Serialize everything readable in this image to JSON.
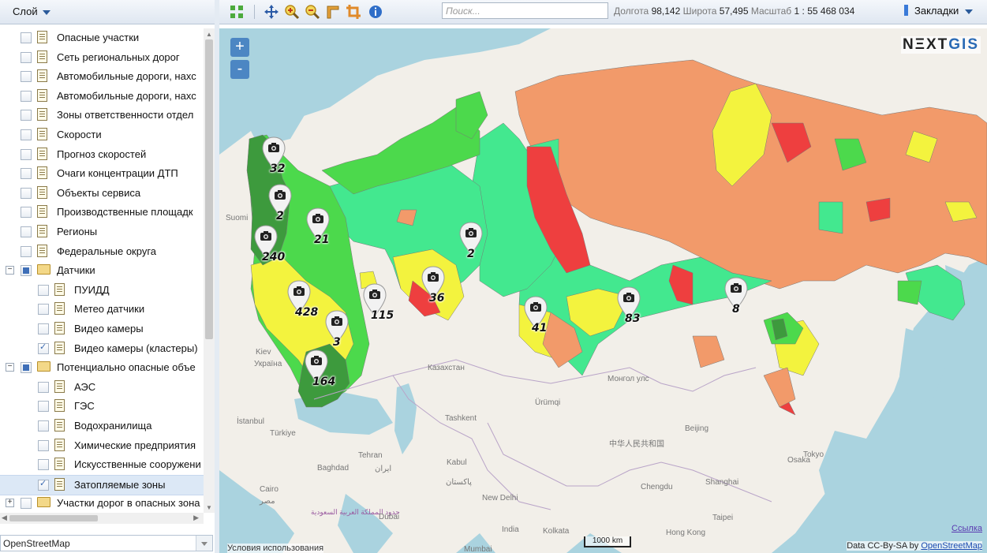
{
  "layer_panel": {
    "title": "Слой",
    "layers": [
      {
        "label": "Опасные участки",
        "checked": false,
        "level": 1,
        "type": "layer"
      },
      {
        "label": "Сеть региональных дорог",
        "checked": false,
        "level": 1,
        "type": "layer"
      },
      {
        "label": "Автомобильные дороги, нахс",
        "checked": false,
        "level": 1,
        "type": "layer"
      },
      {
        "label": "Автомобильные дороги, нахс",
        "checked": false,
        "level": 1,
        "type": "layer"
      },
      {
        "label": "Зоны ответственности отдел",
        "checked": false,
        "level": 1,
        "type": "layer"
      },
      {
        "label": "Скорости",
        "checked": false,
        "level": 1,
        "type": "layer"
      },
      {
        "label": "Прогноз скоростей",
        "checked": false,
        "level": 1,
        "type": "layer"
      },
      {
        "label": "Очаги концентрации ДТП",
        "checked": false,
        "level": 1,
        "type": "layer"
      },
      {
        "label": "Объекты сервиса",
        "checked": false,
        "level": 1,
        "type": "layer"
      },
      {
        "label": "Производственные площадк",
        "checked": false,
        "level": 1,
        "type": "layer"
      },
      {
        "label": "Регионы",
        "checked": false,
        "level": 1,
        "type": "layer"
      },
      {
        "label": "Федеральные округа",
        "checked": false,
        "level": 1,
        "type": "layer"
      },
      {
        "label": "Датчики",
        "checked": "partial",
        "level": 1,
        "type": "group",
        "expander": "−"
      },
      {
        "label": "ПУИДД",
        "checked": false,
        "level": 2,
        "type": "layer"
      },
      {
        "label": "Метео датчики",
        "checked": false,
        "level": 2,
        "type": "layer"
      },
      {
        "label": "Видео камеры",
        "checked": false,
        "level": 2,
        "type": "layer"
      },
      {
        "label": "Видео камеры (кластеры)",
        "checked": true,
        "level": 2,
        "type": "layer"
      },
      {
        "label": "Потенциально опасные объе",
        "checked": "partial",
        "level": 1,
        "type": "group",
        "expander": "−"
      },
      {
        "label": "АЭС",
        "checked": false,
        "level": 2,
        "type": "layer"
      },
      {
        "label": "ГЭС",
        "checked": false,
        "level": 2,
        "type": "layer"
      },
      {
        "label": "Водохранилища",
        "checked": false,
        "level": 2,
        "type": "layer"
      },
      {
        "label": "Химические предприятия",
        "checked": false,
        "level": 2,
        "type": "layer"
      },
      {
        "label": "Искусственные сооружени",
        "checked": false,
        "level": 2,
        "type": "layer"
      },
      {
        "label": "Затопляемые зоны",
        "checked": true,
        "level": 2,
        "type": "layer",
        "selected": true
      },
      {
        "label": "Участки дорог в опасных зона",
        "checked": false,
        "level": 1,
        "type": "group",
        "expander": "+"
      }
    ],
    "basemap": "OpenStreetMap"
  },
  "toolbar": {
    "tools": [
      "zoom-extent-icon",
      "pan-icon",
      "zoom-in-icon",
      "zoom-out-icon",
      "measure-icon",
      "crop-icon",
      "info-icon"
    ],
    "search_placeholder": "Поиск...",
    "lon_label": "Долгота",
    "lon_value": "98,142",
    "lat_label": "Широта",
    "lat_value": "57,495",
    "scale_label": "Масштаб",
    "scale_value": "1 : 55 468 034",
    "bookmarks_label": "Закладки"
  },
  "map": {
    "logo": {
      "part1": "N",
      "part2": "ΞXT",
      "part3": "GIS"
    },
    "zoom_in": "+",
    "zoom_out": "-",
    "link": "Ссылка",
    "attribution_prefix": "Data CC-By-SA by",
    "attribution_link": "OpenStreetMap",
    "terms": "Условия использования",
    "scalebar": "1000 km",
    "place_names": [
      "Suomi",
      "Kiev",
      "Україна",
      "Казахстан",
      "Монгол улс",
      "Ürümqi",
      "Tashkent",
      "Türkiye",
      "İstanbul",
      "Tehran",
      "Baghdad",
      "ایران",
      "Kabul",
      "پاکستان",
      "New Delhi",
      "Cairo",
      "مصر",
      "حدود المملكة العربية السعودية",
      "Dubai",
      "India",
      "Kolkata",
      "Mumbai",
      "中华人民共和国",
      "Beijing",
      "Chengdu",
      "Shanghai",
      "Osaka",
      "Tokyo",
      "Taipei",
      "Hong Kong"
    ],
    "clusters": [
      "32",
      "2",
      "21",
      "240",
      "428",
      "3",
      "115",
      "36",
      "2",
      "41",
      "83",
      "8",
      "164"
    ],
    "colors": {
      "dark_green": "#3d9a3d",
      "green": "#4cd94c",
      "light_green": "#43e88f",
      "yellow": "#f3f33e",
      "orange": "#f29a6a",
      "red": "#ee3f3f",
      "water": "#aad3df",
      "land": "#f2efe9"
    }
  }
}
